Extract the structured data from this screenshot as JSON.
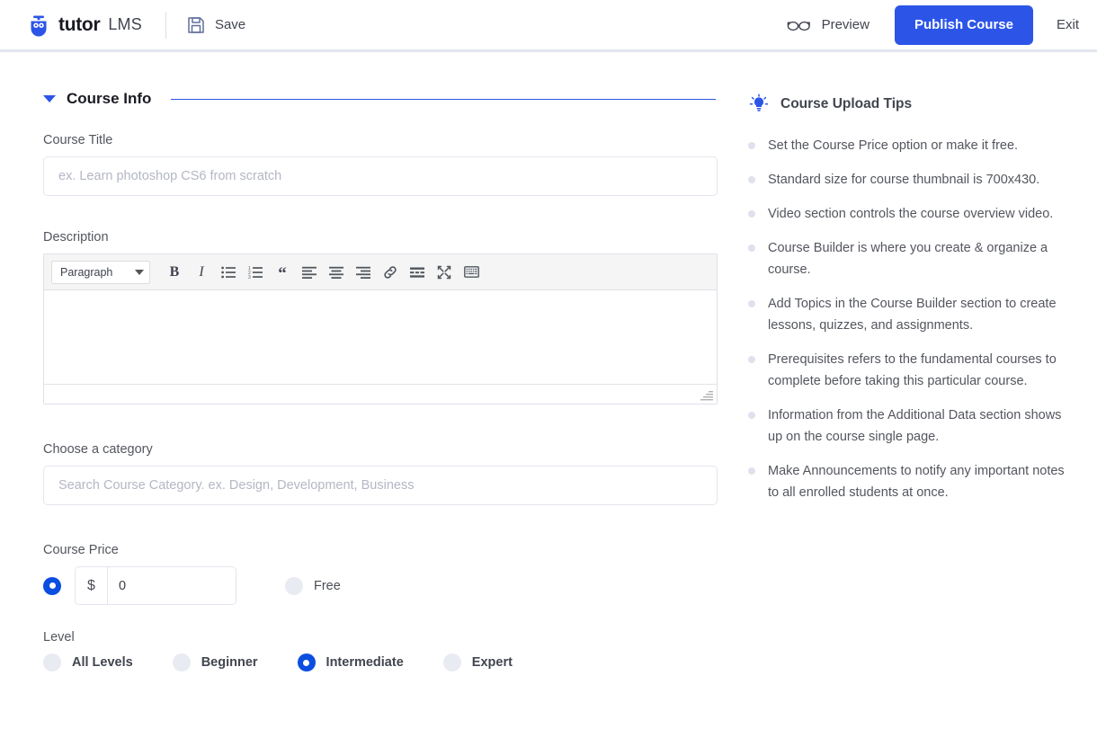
{
  "header": {
    "brand_name": "tutor",
    "brand_sub": "LMS",
    "logo_icon": "owl-logo-icon",
    "save_icon": "floppy-disk-save-icon",
    "save_label": "Save",
    "preview_icon": "glasses-preview-icon",
    "preview_label": "Preview",
    "publish_label": "Publish Course",
    "exit_label": "Exit",
    "accent_color": "#2c55e8"
  },
  "course_info": {
    "section_title": "Course Info",
    "collapse_icon": "caret-down-icon",
    "title_field": {
      "label": "Course Title",
      "value": "",
      "placeholder": "ex. Learn photoshop CS6 from scratch"
    },
    "description_field": {
      "label": "Description",
      "value": "",
      "toolbar": {
        "format_select": "Paragraph",
        "buttons": [
          {
            "name": "bold-button",
            "label": "B"
          },
          {
            "name": "italic-button",
            "label": "I"
          },
          {
            "name": "bulleted-list-button",
            "label": ""
          },
          {
            "name": "numbered-list-button",
            "label": ""
          },
          {
            "name": "blockquote-button",
            "label": "“"
          },
          {
            "name": "align-left-button",
            "label": ""
          },
          {
            "name": "align-center-button",
            "label": ""
          },
          {
            "name": "align-right-button",
            "label": ""
          },
          {
            "name": "insert-link-button",
            "label": ""
          },
          {
            "name": "read-more-button",
            "label": ""
          },
          {
            "name": "fullscreen-button",
            "label": ""
          },
          {
            "name": "toolbar-toggle-button",
            "label": ""
          }
        ]
      }
    },
    "category_field": {
      "label": "Choose a category",
      "value": "",
      "placeholder": "Search Course Category. ex. Design, Development, Business"
    },
    "price_field": {
      "label": "Course Price",
      "currency_symbol": "$",
      "amount": "0",
      "amount_placeholder": "0",
      "paid_selected": true,
      "free_label": "Free",
      "free_selected": false
    },
    "level_field": {
      "label": "Level",
      "options": [
        {
          "label": "All Levels",
          "selected": false
        },
        {
          "label": "Beginner",
          "selected": false
        },
        {
          "label": "Intermediate",
          "selected": true
        },
        {
          "label": "Expert",
          "selected": false
        }
      ]
    }
  },
  "tips": {
    "icon": "lightbulb-icon",
    "title": "Course Upload Tips",
    "items": [
      "Set the Course Price option or make it free.",
      "Standard size for course thumbnail is 700x430.",
      "Video section controls the course overview video.",
      "Course Builder is where you create & organize a course.",
      "Add Topics in the Course Builder section to create lessons, quizzes, and assignments.",
      "Prerequisites refers to the fundamental courses to complete before taking this particular course.",
      "Information from the Additional Data section shows up on the course single page.",
      "Make Announcements to notify any important notes to all enrolled students at once."
    ]
  }
}
